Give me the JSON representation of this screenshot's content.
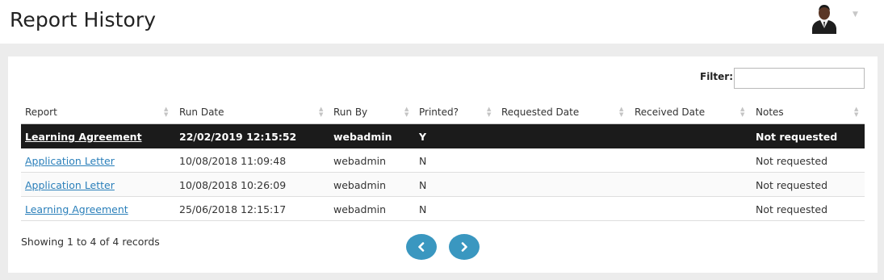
{
  "page": {
    "title": "Report History"
  },
  "user": {
    "avatar": "user-avatar-icon",
    "menu_icon": "caret-down-icon"
  },
  "filter": {
    "label": "Filter:",
    "value": "",
    "placeholder": ""
  },
  "table": {
    "columns": [
      "Report",
      "Run Date",
      "Run By",
      "Printed?",
      "Requested Date",
      "Received Date",
      "Notes"
    ],
    "rows": [
      {
        "report": "Learning Agreement",
        "run_date": "22/02/2019 12:15:52",
        "run_by": "webadmin",
        "printed": "Y",
        "requested_date": "",
        "received_date": "",
        "notes": "Not requested",
        "selected": true
      },
      {
        "report": "Application Letter",
        "run_date": "10/08/2018 11:09:48",
        "run_by": "webadmin",
        "printed": "N",
        "requested_date": "",
        "received_date": "",
        "notes": "Not requested",
        "selected": false
      },
      {
        "report": "Application Letter",
        "run_date": "10/08/2018 10:26:09",
        "run_by": "webadmin",
        "printed": "N",
        "requested_date": "",
        "received_date": "",
        "notes": "Not requested",
        "selected": false
      },
      {
        "report": "Learning Agreement",
        "run_date": "25/06/2018 12:15:17",
        "run_by": "webadmin",
        "printed": "N",
        "requested_date": "",
        "received_date": "",
        "notes": "Not requested",
        "selected": false
      }
    ]
  },
  "pagination": {
    "info": "Showing 1 to 4 of 4 records",
    "prev_icon": "chevron-left-icon",
    "next_icon": "chevron-right-icon"
  },
  "colors": {
    "link": "#2a7fba",
    "selected_row": "#1b1b1b",
    "pager_button": "#3a97c0"
  }
}
